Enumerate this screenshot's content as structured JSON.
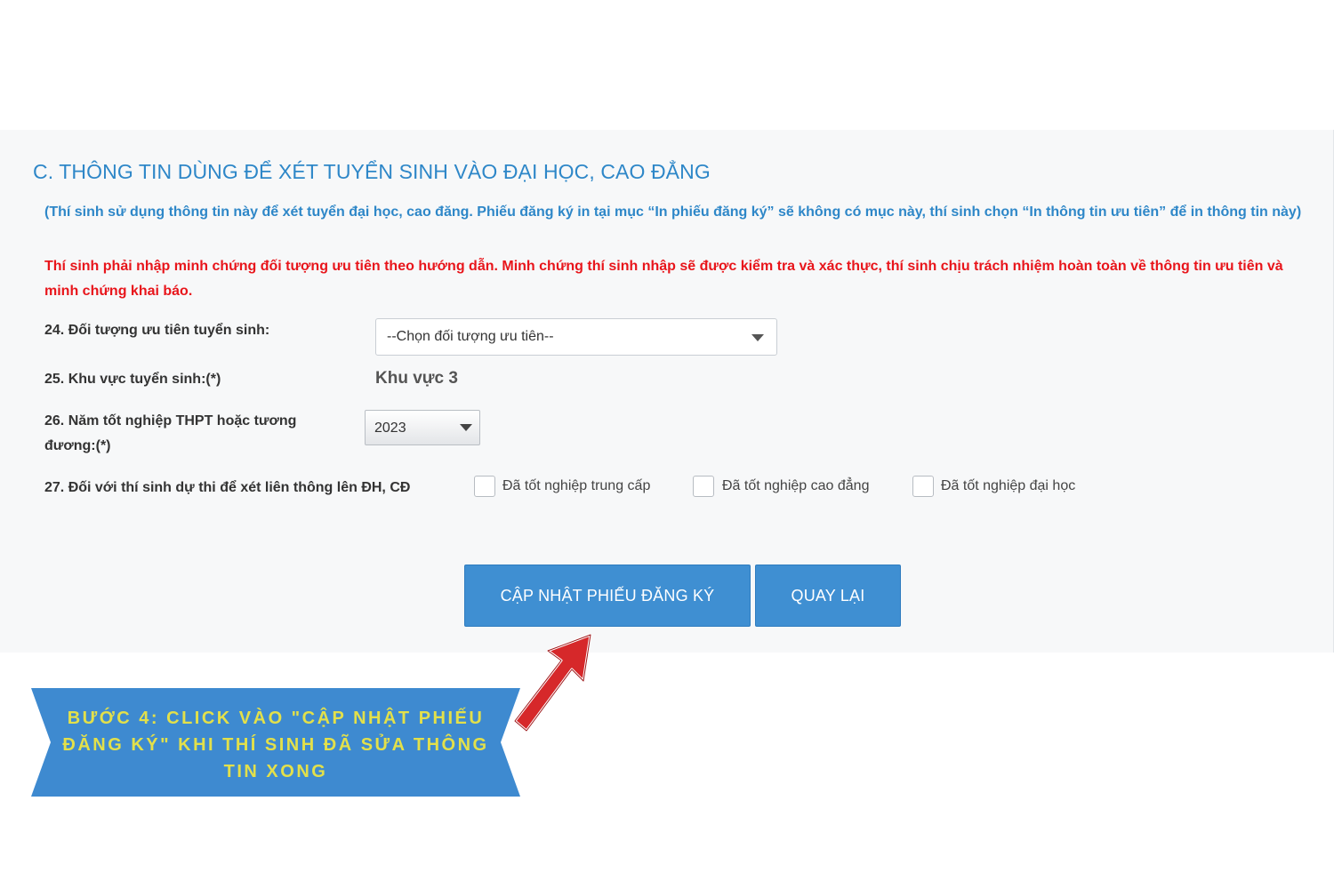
{
  "section": {
    "title": "C. THÔNG TIN DÙNG ĐỂ XÉT TUYỂN SINH VÀO ĐẠI HỌC, CAO ĐẲNG",
    "note_blue": "(Thí sinh sử dụng thông tin này để xét tuyển đại học, cao đăng. Phiếu đăng ký in tại mục “In phiếu đăng ký” sẽ không có mục này, thí sinh chọn “In thông tin ưu tiên” để in thông tin này)",
    "note_red": "Thí sinh phải nhập minh chứng đối tượng ưu tiên theo hướng dẫn. Minh chứng thí sinh nhập sẽ được kiểm tra và xác thực, thí sinh chịu trách nhiệm hoàn toàn về thông tin ưu tiên và minh chứng khai báo."
  },
  "fields": {
    "f24_label": "24. Đối tượng ưu tiên tuyển sinh:",
    "f24_value": "--Chọn đối tượng ưu tiên--",
    "f25_label": "25. Khu vực tuyển sinh:(*)",
    "f25_value": "Khu vực 3",
    "f26_label": "26. Năm tốt nghiệp THPT hoặc tương đương:(*)",
    "f26_value": "2023",
    "f27_label": "27. Đối với thí sinh dự thi để xét liên thông lên ĐH, CĐ",
    "checkboxes": [
      {
        "label": "Đã tốt nghiệp trung cấp",
        "checked": false
      },
      {
        "label": "Đã tốt nghiệp cao đẳng",
        "checked": false
      },
      {
        "label": "Đã tốt nghiệp đại học",
        "checked": false
      }
    ]
  },
  "buttons": {
    "update_label": "CẬP NHẬT PHIẾU ĐĂNG KÝ",
    "back_label": "QUAY LẠI"
  },
  "annotation": {
    "banner_text": "BƯỚC 4: CLICK VÀO \"CẬP NHẬT PHIẾU ĐĂNG KÝ\" KHI THÍ SINH ĐÃ SỬA THÔNG TIN XONG",
    "arrow_icon": "red-arrow-icon"
  },
  "colors": {
    "accent_blue": "#2e87c8",
    "button_blue": "#3f8fd2",
    "warning_red": "#e8151b",
    "banner_blue": "#3e8ad0",
    "banner_text": "#e3e04a",
    "arrow_red": "#d6282a"
  }
}
